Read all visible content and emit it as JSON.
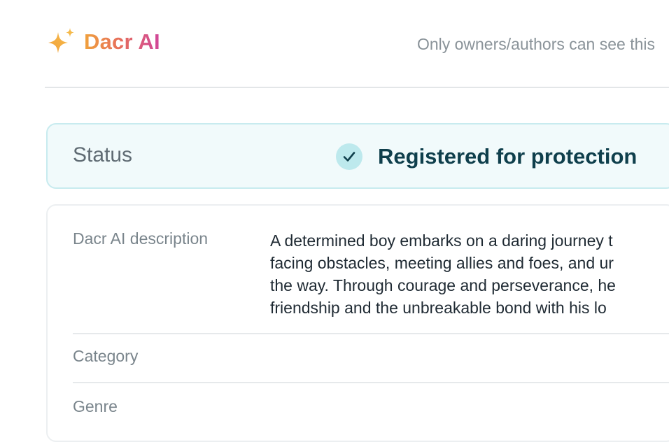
{
  "header": {
    "brand_name": "Dacr AI",
    "visibility_note": "Only owners/authors can see this"
  },
  "status": {
    "label": "Status",
    "value": "Registered for protection",
    "icon": "check-icon",
    "color": "#0f3f4c"
  },
  "details": {
    "rows": [
      {
        "label": "Dacr AI description",
        "lines": [
          "A determined boy embarks on a daring journey t",
          "facing obstacles, meeting allies and foes, and ur",
          "the way. Through courage and perseverance, he",
          "friendship and the unbreakable bond with his lo"
        ]
      },
      {
        "label": "Category",
        "value": ""
      },
      {
        "label": "Genre",
        "value": ""
      }
    ]
  },
  "colors": {
    "brand_gradient": [
      "#f0a23c",
      "#e7705a",
      "#d0469a"
    ],
    "status_bg": "#f1fafb",
    "status_border": "#c8ebef"
  }
}
